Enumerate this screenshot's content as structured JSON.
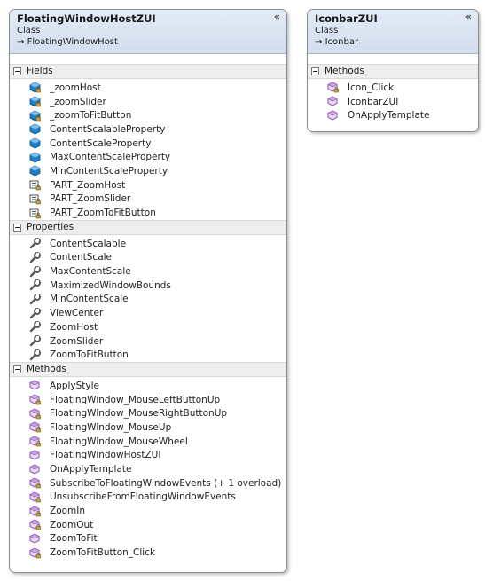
{
  "classes": [
    {
      "name": "FloatingWindowHostZUI",
      "kind": "Class",
      "base": "FloatingWindowHost",
      "sections": [
        {
          "title": "Fields",
          "members": [
            {
              "label": "_zoomHost",
              "icon": "private-field-icon"
            },
            {
              "label": "_zoomSlider",
              "icon": "private-field-icon"
            },
            {
              "label": "_zoomToFitButton",
              "icon": "private-field-icon"
            },
            {
              "label": "ContentScalableProperty",
              "icon": "field-icon"
            },
            {
              "label": "ContentScaleProperty",
              "icon": "field-icon"
            },
            {
              "label": "MaxContentScaleProperty",
              "icon": "field-icon"
            },
            {
              "label": "MinContentScaleProperty",
              "icon": "field-icon"
            },
            {
              "label": "PART_ZoomHost",
              "icon": "private-constant-icon"
            },
            {
              "label": "PART_ZoomSlider",
              "icon": "private-constant-icon"
            },
            {
              "label": "PART_ZoomToFitButton",
              "icon": "private-constant-icon"
            }
          ]
        },
        {
          "title": "Properties",
          "members": [
            {
              "label": "ContentScalable",
              "icon": "property-icon"
            },
            {
              "label": "ContentScale",
              "icon": "property-icon"
            },
            {
              "label": "MaxContentScale",
              "icon": "property-icon"
            },
            {
              "label": "MaximizedWindowBounds",
              "icon": "property-icon"
            },
            {
              "label": "MinContentScale",
              "icon": "property-icon"
            },
            {
              "label": "ViewCenter",
              "icon": "property-icon"
            },
            {
              "label": "ZoomHost",
              "icon": "property-icon"
            },
            {
              "label": "ZoomSlider",
              "icon": "property-icon"
            },
            {
              "label": "ZoomToFitButton",
              "icon": "property-icon"
            }
          ]
        },
        {
          "title": "Methods",
          "members": [
            {
              "label": "ApplyStyle",
              "icon": "method-icon"
            },
            {
              "label": "FloatingWindow_MouseLeftButtonUp",
              "icon": "private-method-icon"
            },
            {
              "label": "FloatingWindow_MouseRightButtonUp",
              "icon": "private-method-icon"
            },
            {
              "label": "FloatingWindow_MouseUp",
              "icon": "private-method-icon"
            },
            {
              "label": "FloatingWindow_MouseWheel",
              "icon": "private-method-icon"
            },
            {
              "label": "FloatingWindowHostZUI",
              "icon": "method-icon"
            },
            {
              "label": "OnApplyTemplate",
              "icon": "method-icon"
            },
            {
              "label": "SubscribeToFloatingWindowEvents (+ 1 overload)",
              "icon": "private-method-icon"
            },
            {
              "label": "UnsubscribeFromFloatingWindowEvents",
              "icon": "private-method-icon"
            },
            {
              "label": "ZoomIn",
              "icon": "private-method-icon"
            },
            {
              "label": "ZoomOut",
              "icon": "private-method-icon"
            },
            {
              "label": "ZoomToFit",
              "icon": "method-icon"
            },
            {
              "label": "ZoomToFitButton_Click",
              "icon": "private-method-icon"
            }
          ]
        }
      ]
    },
    {
      "name": "IconbarZUI",
      "kind": "Class",
      "base": "Iconbar",
      "sections": [
        {
          "title": "Methods",
          "members": [
            {
              "label": "Icon_Click",
              "icon": "private-method-icon"
            },
            {
              "label": "IconbarZUI",
              "icon": "method-icon"
            },
            {
              "label": "OnApplyTemplate",
              "icon": "method-icon"
            }
          ]
        }
      ]
    }
  ],
  "glyphs": {
    "collapse": "«",
    "inherits": "→"
  },
  "colors": {
    "field": "#1e7fc4",
    "method": "#8a52b8",
    "property": "#5a5a5a",
    "constant": "#4a4a4a"
  }
}
